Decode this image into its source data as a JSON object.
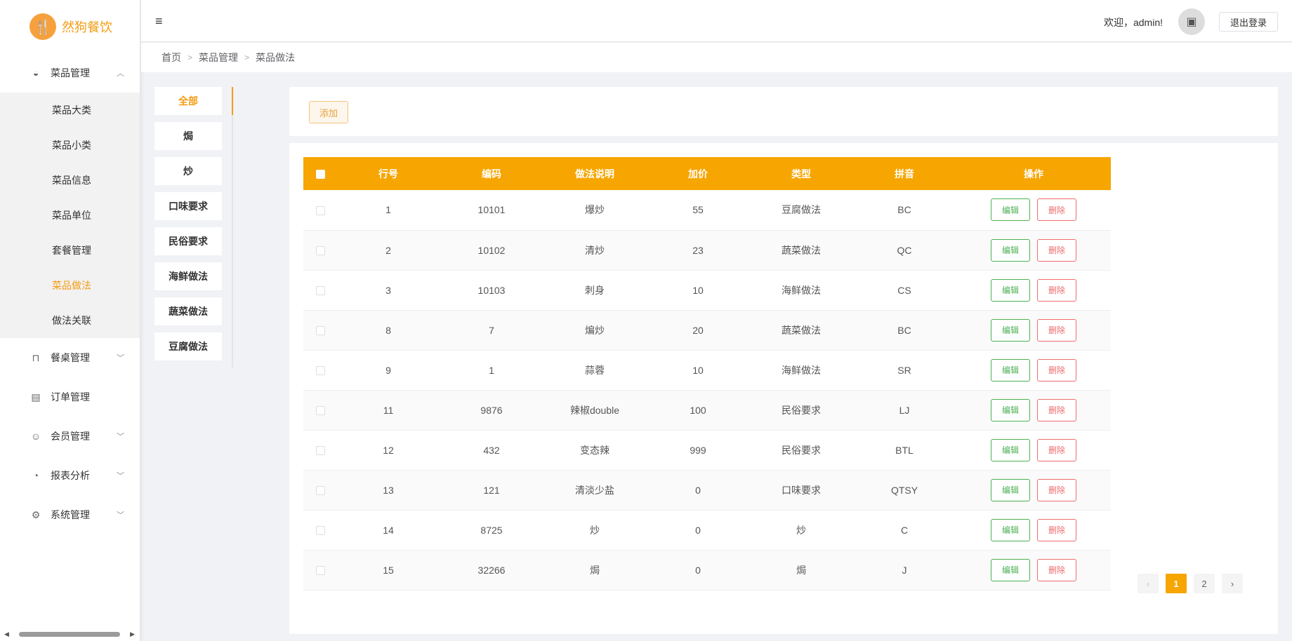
{
  "app": {
    "name": "然狗餐饮"
  },
  "sidebar": {
    "menus": [
      {
        "label": "菜品管理",
        "icon": "bowl-icon",
        "expanded": true
      },
      {
        "label": "餐桌管理",
        "icon": "table-icon"
      },
      {
        "label": "订单管理",
        "icon": "order-icon"
      },
      {
        "label": "会员管理",
        "icon": "user-icon"
      },
      {
        "label": "报表分析",
        "icon": "pie-icon"
      },
      {
        "label": "系统管理",
        "icon": "gear-icon"
      }
    ],
    "submenu": [
      "菜品大类",
      "菜品小类",
      "菜品信息",
      "菜品单位",
      "套餐管理",
      "菜品做法",
      "做法关联"
    ],
    "active_submenu": "菜品做法"
  },
  "header": {
    "welcome": "欢迎，admin!",
    "logout": "退出登录"
  },
  "breadcrumb": [
    "首页",
    "菜品管理",
    "菜品做法"
  ],
  "categories": [
    "全部",
    "焗",
    "炒",
    "口味要求",
    "民俗要求",
    "海鲜做法",
    "蔬菜做法",
    "豆腐做法"
  ],
  "active_category": "全部",
  "toolbar": {
    "add_label": "添加"
  },
  "table": {
    "columns": [
      "行号",
      "编码",
      "做法说明",
      "加价",
      "类型",
      "拼音",
      "操作"
    ],
    "rows": [
      {
        "no": "1",
        "code": "10101",
        "desc": "爆炒",
        "price": "55",
        "type": "豆腐做法",
        "pinyin": "BC"
      },
      {
        "no": "2",
        "code": "10102",
        "desc": "清炒",
        "price": "23",
        "type": "蔬菜做法",
        "pinyin": "QC"
      },
      {
        "no": "3",
        "code": "10103",
        "desc": "刺身",
        "price": "10",
        "type": "海鲜做法",
        "pinyin": "CS"
      },
      {
        "no": "8",
        "code": "7",
        "desc": "煸炒",
        "price": "20",
        "type": "蔬菜做法",
        "pinyin": "BC"
      },
      {
        "no": "9",
        "code": "1",
        "desc": "蒜蓉",
        "price": "10",
        "type": "海鲜做法",
        "pinyin": "SR"
      },
      {
        "no": "11",
        "code": "9876",
        "desc": "辣椒double",
        "price": "100",
        "type": "民俗要求",
        "pinyin": "LJ"
      },
      {
        "no": "12",
        "code": "432",
        "desc": "变态辣",
        "price": "999",
        "type": "民俗要求",
        "pinyin": "BTL"
      },
      {
        "no": "13",
        "code": "121",
        "desc": "清淡少盐",
        "price": "0",
        "type": "口味要求",
        "pinyin": "QTSY"
      },
      {
        "no": "14",
        "code": "8725",
        "desc": "炒",
        "price": "0",
        "type": "炒",
        "pinyin": "C"
      },
      {
        "no": "15",
        "code": "32266",
        "desc": "焗",
        "price": "0",
        "type": "焗",
        "pinyin": "J"
      }
    ],
    "edit_label": "编辑",
    "delete_label": "删除"
  },
  "pagination": {
    "pages": [
      "1",
      "2"
    ],
    "current": "1"
  },
  "colors": {
    "accent": "#f7a500",
    "edit": "#4caf50",
    "delete": "#f06c6c"
  }
}
